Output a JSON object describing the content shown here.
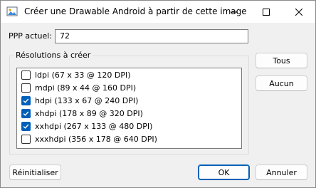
{
  "window": {
    "title": "Créer une Drawable Android à partir de cette image",
    "icon": "android-image-icon"
  },
  "ppp": {
    "label": "PPP actuel:",
    "value": "72"
  },
  "group": {
    "legend": "Résolutions à créer"
  },
  "resolutions": [
    {
      "label": "ldpi (67 x 33 @ 120 DPI)",
      "checked": false
    },
    {
      "label": "mdpi (89 x 44 @ 160 DPI)",
      "checked": false
    },
    {
      "label": "hdpi (133 x 67 @ 240 DPI)",
      "checked": true
    },
    {
      "label": "xhdpi (178 x 89 @ 320 DPI)",
      "checked": true
    },
    {
      "label": "xxhdpi (267 x 133 @ 480 DPI)",
      "checked": true
    },
    {
      "label": "xxxhdpi (356 x 178 @ 640 DPI)",
      "checked": false
    }
  ],
  "buttons": {
    "all": "Tous",
    "none": "Aucun",
    "reset": "Réinitialiser",
    "ok": "OK",
    "cancel": "Annuler"
  },
  "colors": {
    "accent": "#005fb8"
  }
}
